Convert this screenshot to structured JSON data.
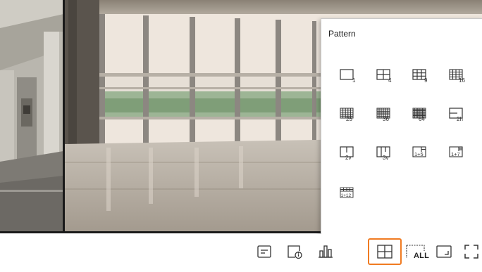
{
  "pattern_panel": {
    "title": "Pattern",
    "patterns": [
      {
        "icon": "layout-1-icon",
        "label": "1"
      },
      {
        "icon": "layout-4-icon",
        "label": "4"
      },
      {
        "icon": "layout-9-icon",
        "label": "9"
      },
      {
        "icon": "layout-16-icon",
        "label": "16"
      },
      {
        "icon": "layout-25-icon",
        "label": "25"
      },
      {
        "icon": "layout-36-icon",
        "label": "36"
      },
      {
        "icon": "layout-64-icon",
        "label": "64"
      },
      {
        "icon": "layout-2h-icon",
        "label": "2h"
      },
      {
        "icon": "layout-2v-icon",
        "label": "2v"
      },
      {
        "icon": "layout-3v-icon",
        "label": "3v"
      },
      {
        "icon": "layout-1plus5-icon",
        "label": "1+5"
      },
      {
        "icon": "layout-1plus7-icon",
        "label": "1+7"
      },
      {
        "icon": "layout-1plus12-icon",
        "label": "1+12"
      }
    ]
  },
  "toolbar": {
    "buttons": [
      {
        "icon": "text-info-icon"
      },
      {
        "icon": "camera-info-icon"
      },
      {
        "icon": "statistics-icon"
      },
      {
        "icon": "layout-pattern-icon",
        "selected": true
      },
      {
        "icon": "all-channels-icon",
        "label": "ALL"
      },
      {
        "icon": "aspect-ratio-icon"
      },
      {
        "icon": "fullscreen-icon"
      }
    ]
  },
  "colors": {
    "accent": "#f07b22",
    "icon_stroke": "#333333"
  }
}
